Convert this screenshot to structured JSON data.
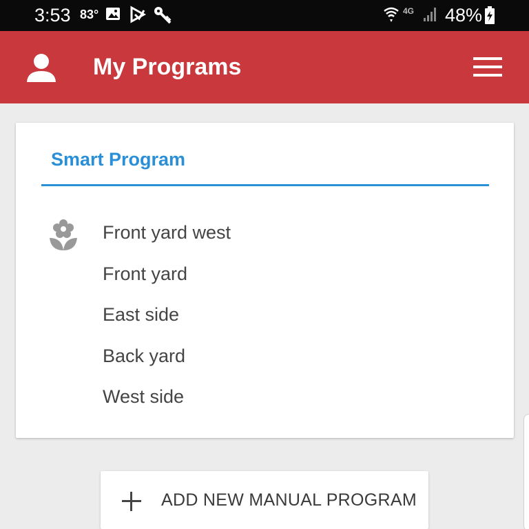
{
  "status_bar": {
    "time": "3:53",
    "temperature": "83°",
    "network": "4G",
    "battery": "48%"
  },
  "app_bar": {
    "title": "My Programs",
    "background_color": "#c8383c"
  },
  "smart_program": {
    "title": "Smart Program",
    "accent_color": "#2b8fd8",
    "icon": "flower-icon",
    "zones": [
      "Front yard west",
      "Front yard",
      "East side",
      "Back yard",
      "West side"
    ]
  },
  "actions": {
    "add_manual_program_label": "ADD NEW MANUAL PROGRAM"
  }
}
